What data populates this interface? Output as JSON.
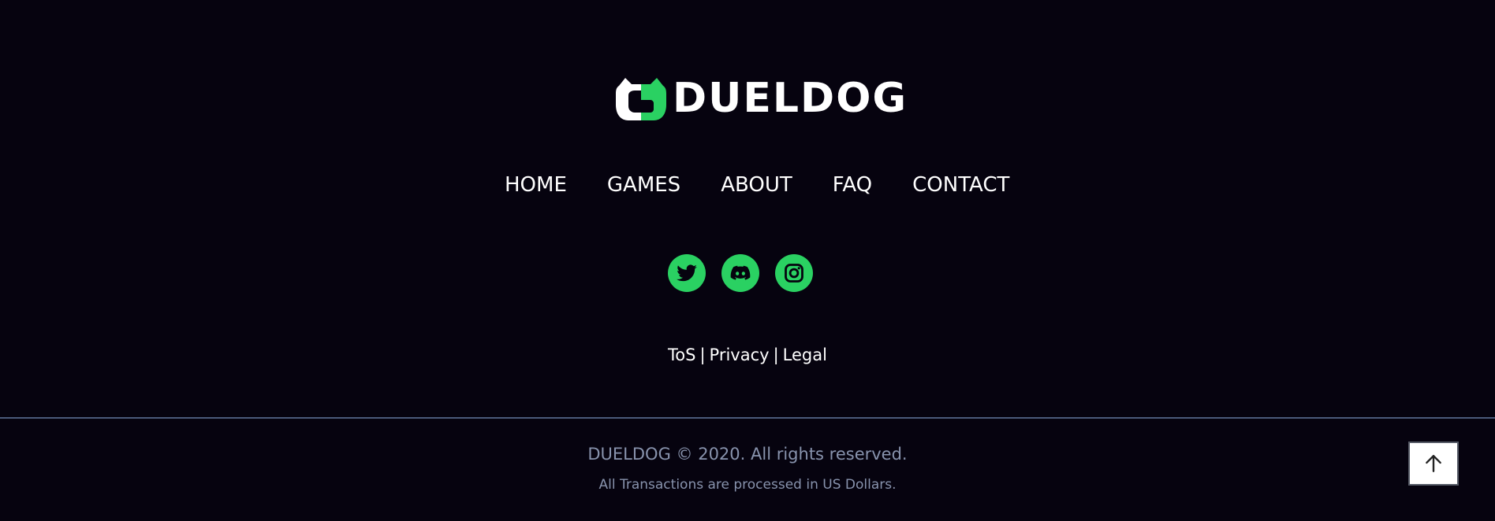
{
  "brand": {
    "name": "DUELDOG",
    "logo_icon": "dueldog-mark",
    "accent_color": "#2ad162"
  },
  "nav": {
    "items": [
      {
        "label": "HOME"
      },
      {
        "label": "GAMES"
      },
      {
        "label": "ABOUT"
      },
      {
        "label": "FAQ"
      },
      {
        "label": "CONTACT"
      }
    ]
  },
  "social": {
    "items": [
      {
        "icon": "twitter-icon"
      },
      {
        "icon": "discord-icon"
      },
      {
        "icon": "instagram-icon"
      }
    ]
  },
  "legal": {
    "tos": "ToS",
    "privacy": "Privacy",
    "legal": "Legal",
    "separator": "|"
  },
  "bottom": {
    "copyright": "DUELDOG © 2020. All rights reserved.",
    "transactions": "All Transactions are processed in US Dollars.",
    "back_to_top_icon": "arrow-up-icon"
  }
}
